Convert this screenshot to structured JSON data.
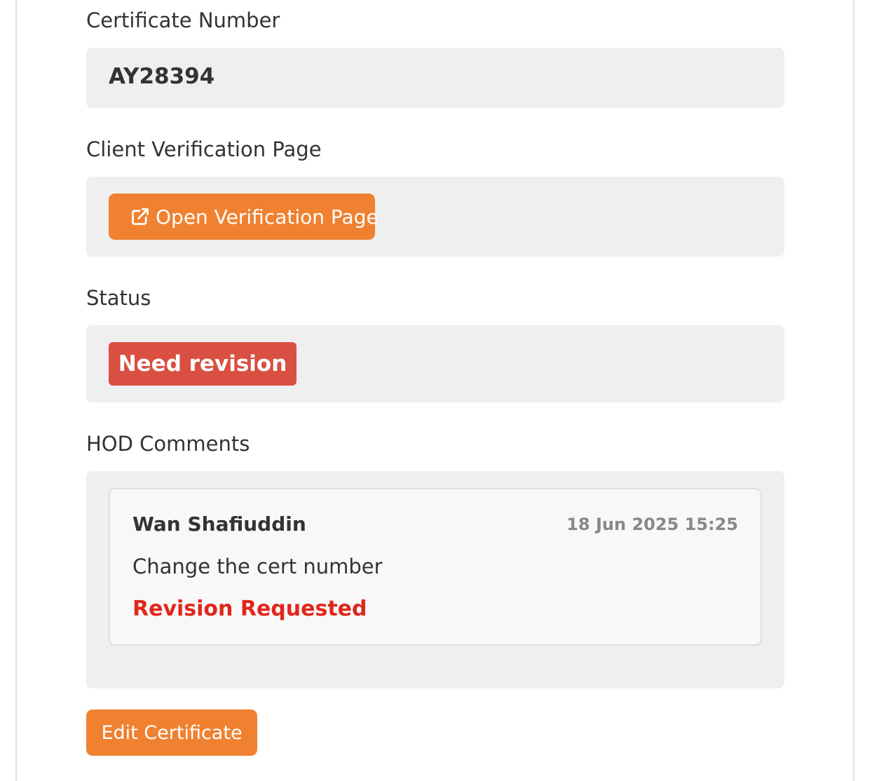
{
  "certificate": {
    "label": "Certificate Number",
    "value": "AY28394"
  },
  "verification": {
    "label": "Client Verification Page",
    "button_label": "Open Verification Page",
    "button_icon": "external-link-icon"
  },
  "status": {
    "label": "Status",
    "badge": "Need revision",
    "badge_color": "#d94f41"
  },
  "hod_comments": {
    "label": "HOD Comments",
    "items": [
      {
        "author": "Wan Shafiuddin",
        "date": "18 Jun 2025 15:25",
        "text": "Change the cert number",
        "status": "Revision Requested",
        "status_color": "#e0261b"
      }
    ]
  },
  "actions": {
    "edit_label": "Edit Certificate"
  },
  "colors": {
    "accent": "#f08130",
    "panel_bg": "#efefef"
  }
}
